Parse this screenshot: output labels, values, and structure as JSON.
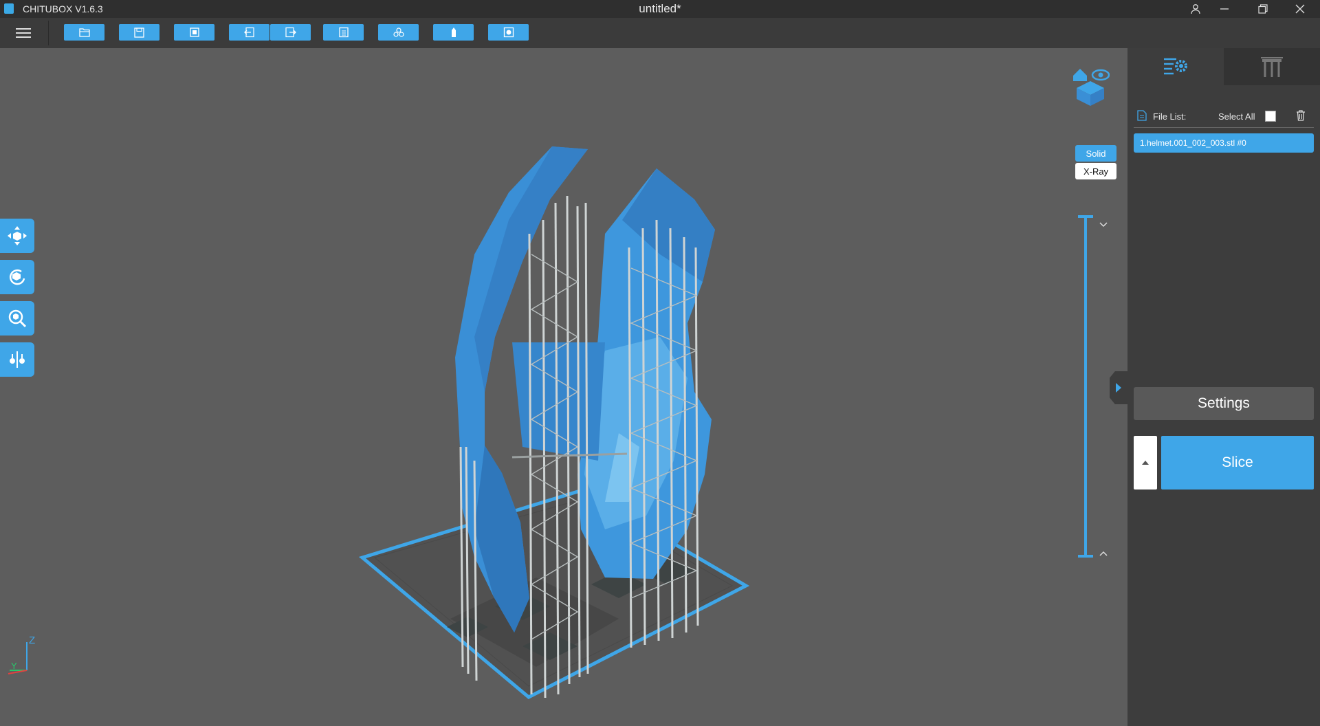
{
  "app": {
    "title": "CHITUBOX V1.6.3",
    "document_title": "untitled*"
  },
  "window_controls": [
    "user-icon",
    "minimize-icon",
    "restore-icon",
    "close-icon"
  ],
  "toolbar": {
    "buttons": [
      "open-file-icon",
      "save-icon",
      "import-icon",
      "undo-icon",
      "redo-icon",
      "layout-icon",
      "duplicate-icon",
      "hollow-icon",
      "settings-icon"
    ]
  },
  "left_tools": [
    "move-icon",
    "rotate-icon",
    "scale-icon",
    "mirror-icon"
  ],
  "view_modes": {
    "solid": "Solid",
    "xray": "X-Ray",
    "active": "Solid"
  },
  "layer_slider": {
    "top_fraction": 1.0,
    "bottom_fraction": 0.0
  },
  "panel": {
    "tabs": [
      "model-settings-tab",
      "support-tab"
    ],
    "file_list_label": "File List:",
    "select_all_label": "Select All",
    "files": [
      "1.helmet.001_002_003.stl #0"
    ],
    "settings_label": "Settings",
    "slice_label": "Slice"
  },
  "colors": {
    "accent": "#3fa6e8",
    "background": "#5b5b5b",
    "panel": "#3d3d3d",
    "model": "#3b8fd6",
    "supports": "#cfd4d4"
  },
  "axis": {
    "z": "Z",
    "y": "Y"
  }
}
